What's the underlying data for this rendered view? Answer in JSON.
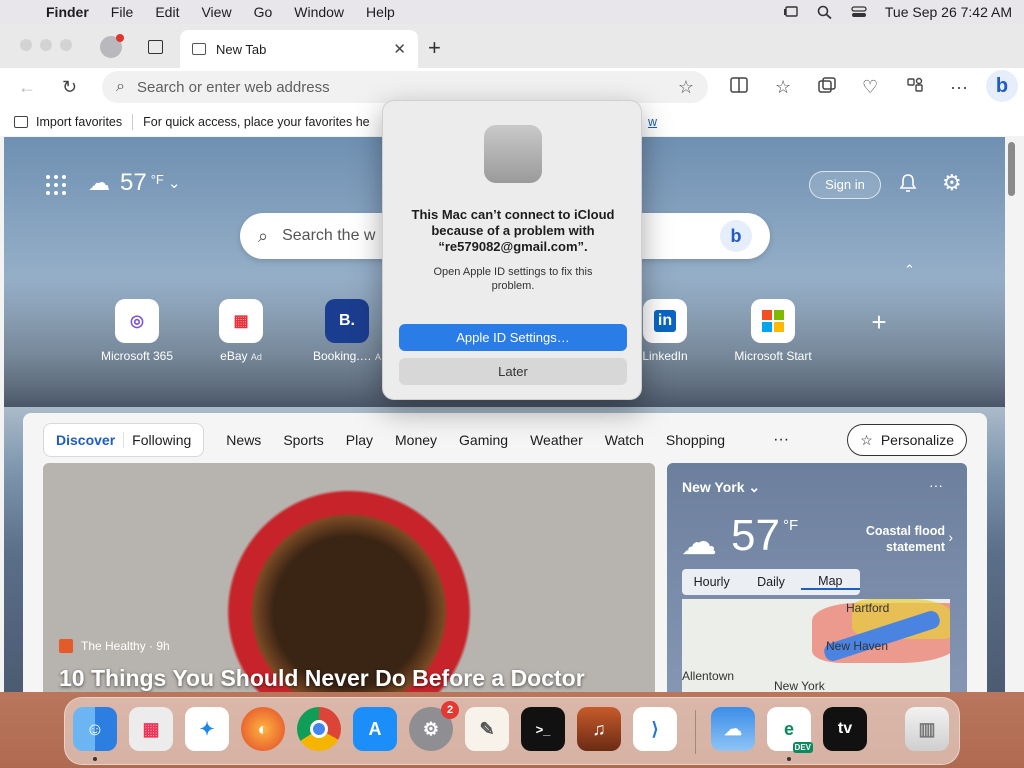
{
  "menubar": {
    "app": "Finder",
    "items": [
      "File",
      "Edit",
      "View",
      "Go",
      "Window",
      "Help"
    ],
    "datetime": "Tue Sep 26  7:42 AM"
  },
  "browser": {
    "tab_title": "New Tab",
    "address_placeholder": "Search or enter web address",
    "favorites_import": "Import favorites",
    "favorites_hint": "For quick access, place your favorites he",
    "favorites_link": "w"
  },
  "ntp": {
    "weather_temp": "57",
    "weather_unit": "°F",
    "signin": "Sign in",
    "search_placeholder": "Search the w",
    "tiles": [
      {
        "label": "Microsoft 365",
        "ad": ""
      },
      {
        "label": "eBay",
        "ad": "Ad"
      },
      {
        "label": "Booking.…",
        "ad": "A"
      },
      {
        "label": "LinkedIn",
        "ad": ""
      },
      {
        "label": "Microsoft Start",
        "ad": ""
      }
    ],
    "feed_tabs": {
      "discover": "Discover",
      "following": "Following",
      "items": [
        "News",
        "Sports",
        "Play",
        "Money",
        "Gaming",
        "Weather",
        "Watch",
        "Shopping"
      ],
      "more": "···",
      "personalize": "Personalize"
    },
    "hero": {
      "source": "The Healthy · 9h",
      "title": "10 Things You Should Never Do Before a Doctor"
    },
    "weather_card": {
      "city": "New York",
      "temp": "57",
      "unit": "°F",
      "alert": "Coastal flood statement",
      "tabs": [
        "Hourly",
        "Daily",
        "Map"
      ],
      "active_tab": "Map",
      "map_labels": [
        "Hartford",
        "New Haven",
        "Allentown",
        "New York"
      ]
    }
  },
  "dialog": {
    "title": "This Mac can’t connect to iCloud because of a problem with “re579082@gmail.com”.",
    "message": "Open Apple ID settings to fix this problem.",
    "primary": "Apple ID Settings…",
    "secondary": "Later"
  },
  "dock": {
    "settings_badge": "2",
    "icons": [
      "finder-icon",
      "launchpad-icon",
      "safari-icon",
      "firefox-icon",
      "chrome-icon",
      "app-store-icon",
      "system-settings-icon",
      "textedit-icon",
      "terminal-icon",
      "garageband-icon",
      "vscode-icon",
      "weather-icon",
      "edge-dev-icon",
      "apple-tv-icon",
      "trash-icon"
    ],
    "edge_dev_label": "DEV",
    "tv_label": "tv"
  }
}
